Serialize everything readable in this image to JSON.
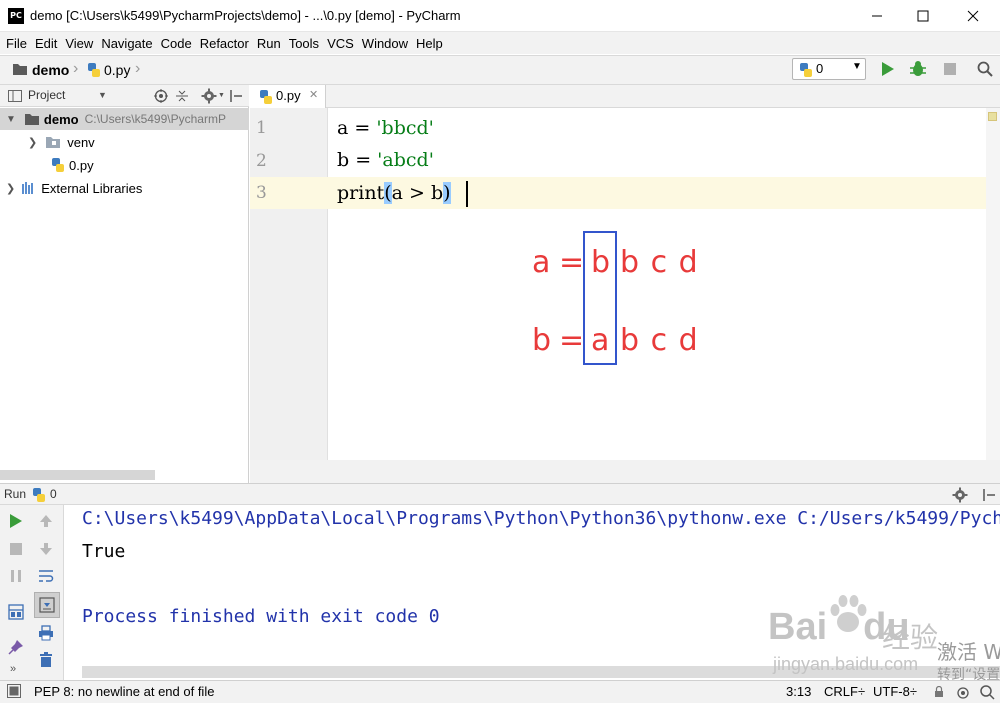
{
  "window": {
    "title": "demo [C:\\Users\\k5499\\PycharmProjects\\demo] - ...\\0.py [demo] - PyCharm",
    "logo_text": "PC"
  },
  "menu": [
    "File",
    "Edit",
    "View",
    "Navigate",
    "Code",
    "Refactor",
    "Run",
    "Tools",
    "VCS",
    "Window",
    "Help"
  ],
  "breadcrumb": {
    "project": "demo",
    "file": "0.py"
  },
  "toolbar": {
    "run_config": "0"
  },
  "project_panel": {
    "title": "Project",
    "tree": [
      {
        "label": "demo",
        "path": "C:\\Users\\k5499\\PycharmP"
      },
      {
        "label": "venv"
      },
      {
        "label": "0.py"
      },
      {
        "label": "External Libraries"
      }
    ]
  },
  "editor": {
    "tab_label": "0.py",
    "lines": [
      {
        "num": "1",
        "pre": "a = ",
        "str": "'bbcd'"
      },
      {
        "num": "2",
        "pre": "b = ",
        "str": "'abcd'"
      },
      {
        "num": "3",
        "fn": "print",
        "open": "(",
        "mid": "a > b",
        "close": ")"
      }
    ]
  },
  "annotation": {
    "row1": {
      "lhs": "a",
      "eq": "=",
      "highlight": "b",
      "rest": "b c d"
    },
    "row2": {
      "lhs": "b",
      "eq": "=",
      "highlight": "a",
      "rest": "b c d"
    }
  },
  "run_panel": {
    "title": "Run",
    "config": "0",
    "console": {
      "command": "C:\\Users\\k5499\\AppData\\Local\\Programs\\Python\\Python36\\pythonw.exe C:/Users/k5499/Pych",
      "output": "True",
      "exit": "Process finished with exit code 0"
    }
  },
  "status": {
    "message": "PEP 8: no newline at end of file",
    "position": "3:13",
    "line_ending": "CRLF÷",
    "encoding": "UTF-8÷"
  },
  "watermark": {
    "brand": "Bai",
    "brand2": "du",
    "jingyan": "经验",
    "url": "jingyan.baidu.com",
    "activate": "激活 W",
    "activate2": "转到“设置"
  },
  "colors": {
    "annotation_red": "#e83a3a",
    "annotation_box": "#3355cc",
    "string_green": "#067d17",
    "console_blue": "#2233aa"
  }
}
